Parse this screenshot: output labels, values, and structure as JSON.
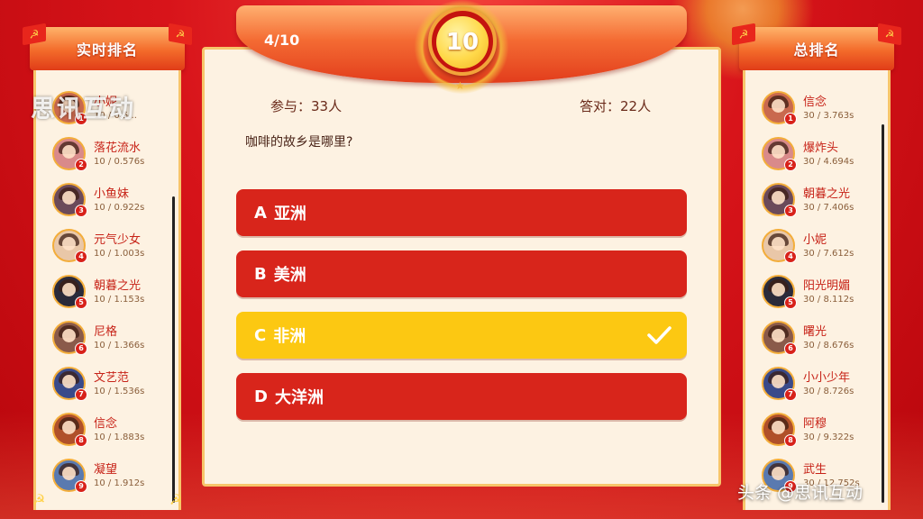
{
  "theme": {
    "primary_red": "#d8251b",
    "correct_yellow": "#fcc812",
    "card_bg": "#fdf2e2",
    "panel_border": "#f7c56a"
  },
  "live_ranking": {
    "title": "实时排名",
    "items": [
      {
        "rank": "1",
        "name": "小妮",
        "score": "10 / 0.5..."
      },
      {
        "rank": "2",
        "name": "落花流水",
        "score": "10 / 0.576s"
      },
      {
        "rank": "3",
        "name": "小鱼妹",
        "score": "10 / 0.922s"
      },
      {
        "rank": "4",
        "name": "元气少女",
        "score": "10 / 1.003s"
      },
      {
        "rank": "5",
        "name": "朝暮之光",
        "score": "10 / 1.153s"
      },
      {
        "rank": "6",
        "name": "尼格",
        "score": "10 / 1.366s"
      },
      {
        "rank": "7",
        "name": "文艺范",
        "score": "10 / 1.536s"
      },
      {
        "rank": "8",
        "name": "信念",
        "score": "10 / 1.883s"
      },
      {
        "rank": "9",
        "name": "凝望",
        "score": "10 / 1.912s"
      }
    ]
  },
  "total_ranking": {
    "title": "总排名",
    "items": [
      {
        "rank": "1",
        "name": "信念",
        "score": "30 / 3.763s"
      },
      {
        "rank": "2",
        "name": "爆炸头",
        "score": "30 / 4.694s"
      },
      {
        "rank": "3",
        "name": "朝暮之光",
        "score": "30 / 7.406s"
      },
      {
        "rank": "4",
        "name": "小妮",
        "score": "30 / 7.612s"
      },
      {
        "rank": "5",
        "name": "阳光明媚",
        "score": "30 / 8.112s"
      },
      {
        "rank": "6",
        "name": "曙光",
        "score": "30 / 8.676s"
      },
      {
        "rank": "7",
        "name": "小小少年",
        "score": "30 / 8.726s"
      },
      {
        "rank": "8",
        "name": "阿穆",
        "score": "30 / 9.322s"
      },
      {
        "rank": "9",
        "name": "武生",
        "score": "30 / 12.752s"
      }
    ]
  },
  "quiz": {
    "progress": "4/10",
    "countdown": "10",
    "participants": "参与：33人",
    "correct_count": "答对：22人",
    "question": "咖啡的故乡是哪里?",
    "options": [
      {
        "letter": "A",
        "text": "亚洲",
        "correct": false
      },
      {
        "letter": "B",
        "text": "美洲",
        "correct": false
      },
      {
        "letter": "C",
        "text": "非洲",
        "correct": true
      },
      {
        "letter": "D",
        "text": "大洋洲",
        "correct": false
      }
    ]
  },
  "watermarks": {
    "top": "思讯互动",
    "bottom": "头条 @思讯互动"
  }
}
